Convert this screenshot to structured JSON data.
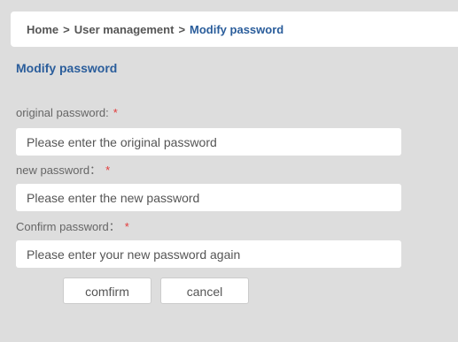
{
  "breadcrumb": {
    "items": [
      "Home",
      "User management",
      "Modify password"
    ],
    "separator": ">"
  },
  "section_title": "Modify password",
  "form": {
    "fields": [
      {
        "label": "original password:",
        "required_mark": "*",
        "value": "",
        "placeholder": "Please enter the original password"
      },
      {
        "label": "new password：",
        "required_mark": "*",
        "value": "",
        "placeholder": "Please enter the new password"
      },
      {
        "label": "Confirm password：",
        "required_mark": "*",
        "value": "",
        "placeholder": "Please enter your new password again"
      }
    ],
    "confirm_label": "comfirm",
    "cancel_label": "cancel"
  },
  "colors": {
    "background": "#dddddd",
    "accent": "#2a5d9b",
    "required": "#e23b3b"
  }
}
